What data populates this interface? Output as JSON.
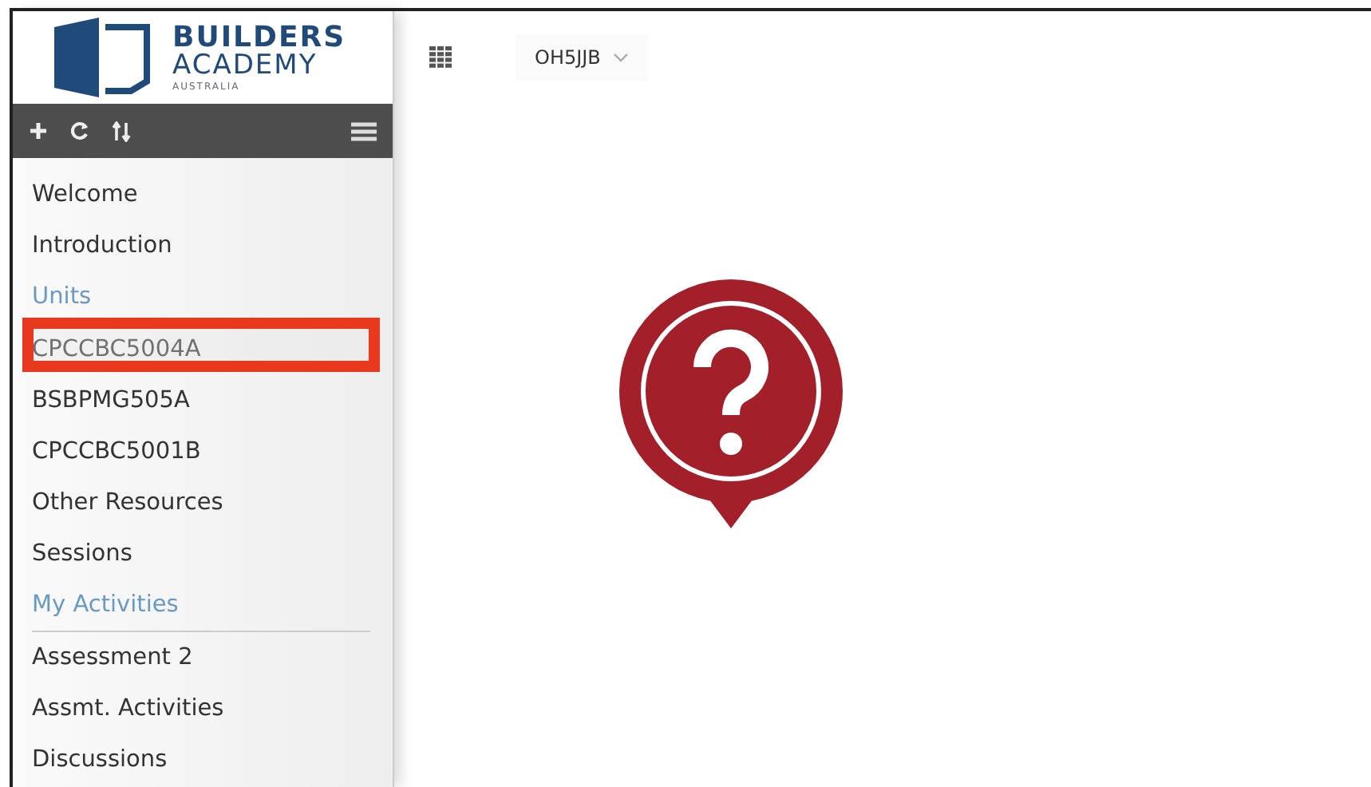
{
  "logo": {
    "line_1": "BUILDERS",
    "line_2": "ACADEMY",
    "line_3": "AUSTRALIA"
  },
  "toolbar": {
    "buttons": [
      {
        "kind": "plus"
      },
      {
        "kind": "refresh"
      },
      {
        "kind": "sort"
      },
      {
        "kind": "menu"
      }
    ]
  },
  "course_selector": {
    "value": "OH5JJB"
  },
  "sidebar": {
    "items": [
      {
        "kind": "item",
        "label": "Welcome",
        "selected": false
      },
      {
        "kind": "item",
        "label": "Introduction",
        "selected": false
      },
      {
        "kind": "header",
        "label": "Units",
        "selected": false
      },
      {
        "kind": "item",
        "label": "CPCCBC5004A",
        "selected": true
      },
      {
        "kind": "item",
        "label": "BSBPMG505A",
        "selected": false
      },
      {
        "kind": "item",
        "label": "CPCCBC5001B",
        "selected": false
      },
      {
        "kind": "item",
        "label": "Other Resources",
        "selected": false
      },
      {
        "kind": "item",
        "label": "Sessions",
        "selected": false
      },
      {
        "kind": "header",
        "label": "My Activities",
        "selected": false
      },
      {
        "kind": "item",
        "label": "Assessment 2",
        "selected": false
      },
      {
        "kind": "item",
        "label": "Assmt. Activities",
        "selected": false
      },
      {
        "kind": "item",
        "label": "Discussions",
        "selected": false
      }
    ]
  }
}
